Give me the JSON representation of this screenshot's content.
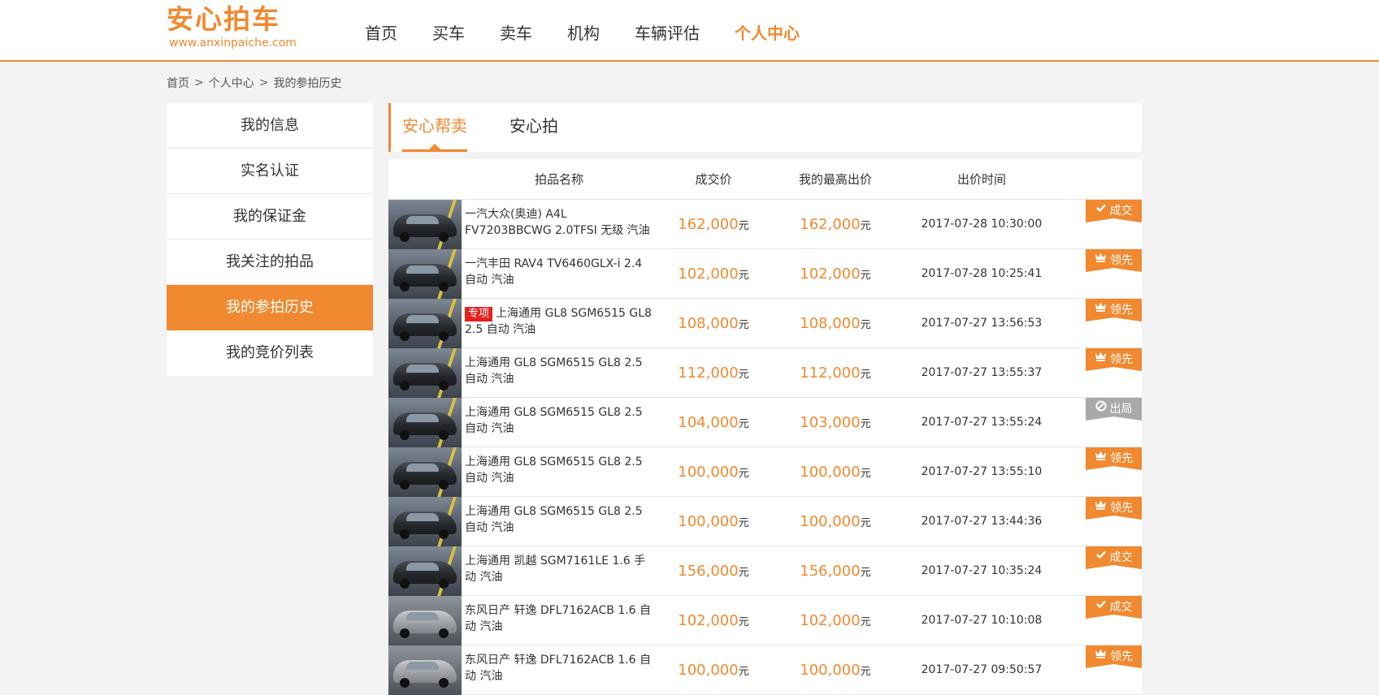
{
  "header": {
    "logo_cn": "安心拍车",
    "logo_en": "www.anxinpaiche.com",
    "nav": [
      "首页",
      "买车",
      "卖车",
      "机构",
      "车辆评估",
      "个人中心"
    ],
    "active_nav": "个人中心"
  },
  "breadcrumb": [
    "首页",
    "个人中心",
    "我的参拍历史"
  ],
  "breadcrumb_sep": ">",
  "sidebar": {
    "items": [
      "我的信息",
      "实名认证",
      "我的保证金",
      "我关注的拍品",
      "我的参拍历史",
      "我的竞价列表"
    ],
    "active": "我的参拍历史"
  },
  "tabs": {
    "items": [
      "安心帮卖",
      "安心拍"
    ],
    "active": "安心帮卖"
  },
  "table": {
    "headers": [
      "拍品名称",
      "成交价",
      "我的最高出价",
      "出价时间"
    ],
    "unit": "元",
    "rows": [
      {
        "name": "一汽大众(奥迪) A4L FV7203BBCWG 2.0TFSI 无级 汽油",
        "tag": "",
        "deal": "162,000",
        "max": "162,000",
        "time": "2017-07-28 10:30:00",
        "status": "成交",
        "status_icon": "check-icon",
        "thumb": "dark"
      },
      {
        "name": "一汽丰田 RAV4 TV6460GLX-i 2.4 自动 汽油",
        "tag": "",
        "deal": "102,000",
        "max": "102,000",
        "time": "2017-07-28 10:25:41",
        "status": "领先",
        "status_icon": "crown-icon",
        "thumb": "dark"
      },
      {
        "name": "上海通用 GL8 SGM6515 GL8 2.5 自动 汽油",
        "tag": "专项",
        "deal": "108,000",
        "max": "108,000",
        "time": "2017-07-27 13:56:53",
        "status": "领先",
        "status_icon": "crown-icon",
        "thumb": "dark"
      },
      {
        "name": "上海通用 GL8 SGM6515 GL8 2.5 自动 汽油",
        "tag": "",
        "deal": "112,000",
        "max": "112,000",
        "time": "2017-07-27 13:55:37",
        "status": "领先",
        "status_icon": "crown-icon",
        "thumb": "dark"
      },
      {
        "name": "上海通用 GL8 SGM6515 GL8 2.5 自动 汽油",
        "tag": "",
        "deal": "104,000",
        "max": "103,000",
        "time": "2017-07-27 13:55:24",
        "status": "出局",
        "status_icon": "ban-icon",
        "thumb": "dark"
      },
      {
        "name": "上海通用 GL8 SGM6515 GL8 2.5 自动 汽油",
        "tag": "",
        "deal": "100,000",
        "max": "100,000",
        "time": "2017-07-27 13:55:10",
        "status": "领先",
        "status_icon": "crown-icon",
        "thumb": "dark"
      },
      {
        "name": "上海通用 GL8 SGM6515 GL8 2.5 自动 汽油",
        "tag": "",
        "deal": "100,000",
        "max": "100,000",
        "time": "2017-07-27 13:44:36",
        "status": "领先",
        "status_icon": "crown-icon",
        "thumb": "dark"
      },
      {
        "name": "上海通用 凯越 SGM7161LE 1.6 手动 汽油",
        "tag": "",
        "deal": "156,000",
        "max": "156,000",
        "time": "2017-07-27 10:35:24",
        "status": "成交",
        "status_icon": "check-icon",
        "thumb": "dark"
      },
      {
        "name": "东风日产 轩逸 DFL7162ACB 1.6 自动 汽油",
        "tag": "",
        "deal": "102,000",
        "max": "102,000",
        "time": "2017-07-27 10:10:08",
        "status": "成交",
        "status_icon": "check-icon",
        "thumb": "silver"
      },
      {
        "name": "东风日产 轩逸 DFL7162ACB 1.6 自动 汽油",
        "tag": "",
        "deal": "100,000",
        "max": "100,000",
        "time": "2017-07-27 09:50:57",
        "status": "领先",
        "status_icon": "crown-icon",
        "thumb": "silver"
      }
    ]
  },
  "colors": {
    "accent": "#f0892f",
    "tag_red": "#e4211f",
    "out_grey": "#a9a9a9"
  }
}
